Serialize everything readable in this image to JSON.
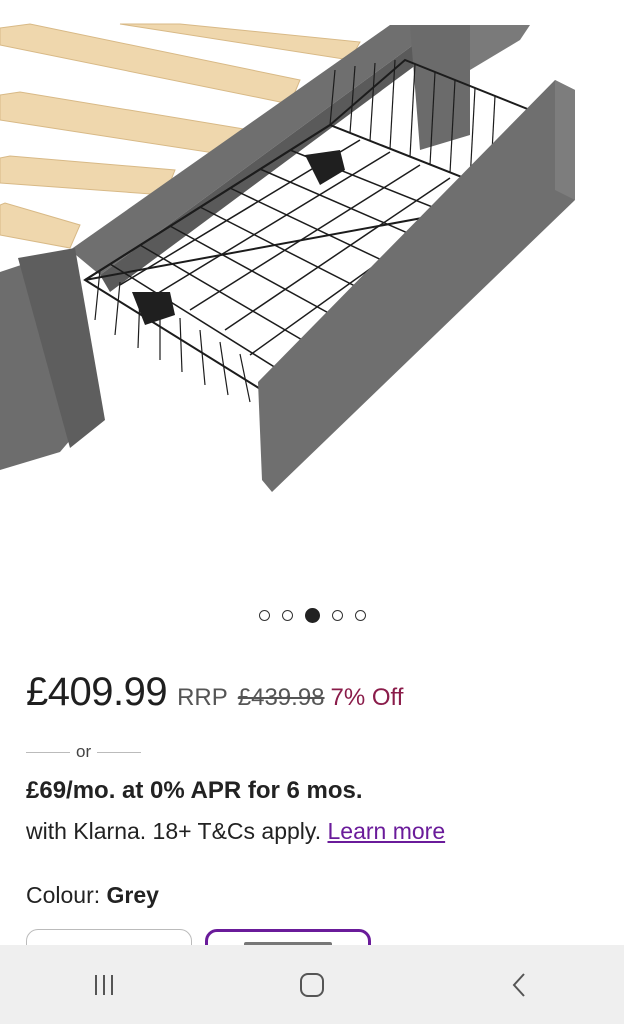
{
  "product": {
    "image_alt": "Grey upholstered bed frame with pull-out wire storage drawer",
    "carousel": {
      "count": 5,
      "active_index": 2
    }
  },
  "pricing": {
    "price": "£409.99",
    "rrp_label": "RRP",
    "was_price": "£439.98",
    "discount": "7% Off"
  },
  "financing": {
    "or_label": "or",
    "headline": "£69/mo. at 0% APR for 6 mos.",
    "sub_text": "with Klarna. 18+ T&Cs apply.",
    "learn_more": "Learn more"
  },
  "colour": {
    "label": "Colour:",
    "value": "Grey"
  },
  "system_nav": {
    "recent": "recent-apps-icon",
    "home": "home-icon",
    "back": "back-icon"
  }
}
